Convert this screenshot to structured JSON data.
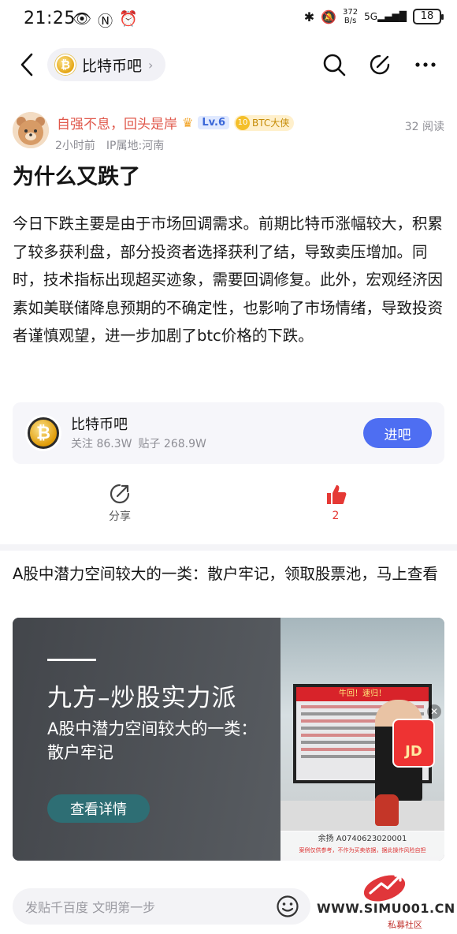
{
  "status_bar": {
    "time": "21:25",
    "net_speed_value": "372",
    "net_speed_unit": "B/s",
    "signal": "5G",
    "battery": "18"
  },
  "nav": {
    "forum_name": "比特币吧",
    "chevron": "›"
  },
  "author": {
    "name": "自强不息，回头是岸",
    "level": "Lv.6",
    "badge_num": "10",
    "badge_text": "BTC大侠",
    "time_ago": "2小时前",
    "ip_location": "IP属地:河南",
    "reads": "32 阅读"
  },
  "post": {
    "title": "为什么又跌了",
    "body": "今日下跌主要是由于市场回调需求。前期比特币涨幅较大，积累了较多获利盘，部分投资者选择获利了结，导致卖压增加。同时，技术指标出现超买迹象，需要回调修复。此外，宏观经济因素如美联储降息预期的不确定性，也影响了市场情绪，导致投资者谨慎观望，进一步加剧了btc价格的下跌。"
  },
  "forum_card": {
    "name": "比特币吧",
    "followers": "关注 86.3W",
    "posts": "贴子 268.9W",
    "enter_label": "进吧"
  },
  "actions": {
    "share_label": "分享",
    "like_count": "2"
  },
  "ad": {
    "title": "A股中潜力空间较大的一类：散户牢记，领取股票池，马上查看",
    "headline": "九方–炒股实力派",
    "subline": "A股中潜力空间较大的一类：散户牢记",
    "cta": "查看详情",
    "screen_banner": "牛回！速归！",
    "redbag_label": "JD",
    "caption": "余扬 A0740623020001",
    "caption_small": "案例仅供参考，不作为买卖依据，据此操作风险自担"
  },
  "bottom": {
    "reply_placeholder": "发贴千百度 文明第一步",
    "watermark": "WWW.SIMU001.CN",
    "watermark_sub": "私募社区"
  },
  "colors": {
    "accent_blue": "#4e6ef2",
    "author_red": "#e0584b",
    "like_red": "#e53935"
  }
}
